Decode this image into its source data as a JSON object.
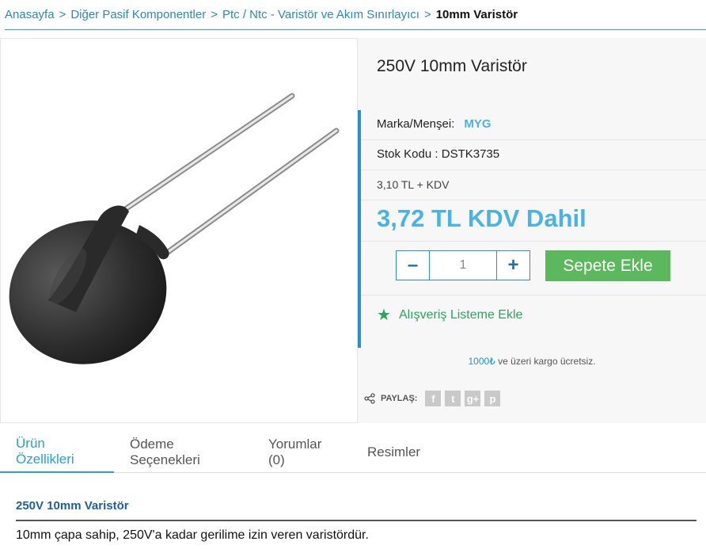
{
  "breadcrumb": {
    "items": [
      "Anasayfa",
      "Diğer Pasif Komponentler",
      "Ptc / Ntc - Varistör ve Akım Sınırlayıcı"
    ],
    "separator": ">",
    "current": "10mm Varistör"
  },
  "product": {
    "title": "250V 10mm Varistör",
    "brand_label": "Marka/Menşei:",
    "brand_value": "MYG",
    "stock_code_label": "Stok Kodu :",
    "stock_code_value": "DSTK3735",
    "price_ex_vat": "3,10 TL + KDV",
    "price_inc_vat": "3,72 TL KDV Dahil",
    "image_icon": "varistor-component-image"
  },
  "cart": {
    "minus_label": "–",
    "plus_label": "+",
    "quantity": "1",
    "add_label": "Sepete Ekle"
  },
  "wishlist": {
    "icon": "star-icon",
    "label": "Alışveriş Listeme Ekle"
  },
  "cargo": {
    "amount": "1000₺",
    "text": " ve üzeri kargo ücretsiz."
  },
  "share": {
    "label": "PAYLAŞ:",
    "networks": [
      {
        "name": "facebook",
        "glyph": "f"
      },
      {
        "name": "twitter",
        "glyph": "t"
      },
      {
        "name": "google-plus",
        "glyph": "g+"
      },
      {
        "name": "pinterest",
        "glyph": "p"
      }
    ]
  },
  "tabs": [
    {
      "label": "Ürün Özellikleri",
      "active": true
    },
    {
      "label": "Ödeme Seçenekleri",
      "active": false
    },
    {
      "label": "Yorumlar (0)",
      "active": false
    },
    {
      "label": "Resimler",
      "active": false
    }
  ],
  "description": {
    "title": "250V 10mm Varistör",
    "text": "10mm çapa sahip, 250V'a kadar gerilime izin veren varistördür."
  },
  "colors": {
    "accent": "#2a8fd0",
    "price": "#4ab3e6",
    "add_to_cart": "#5cb85c",
    "wishlist": "#2aa55f"
  }
}
